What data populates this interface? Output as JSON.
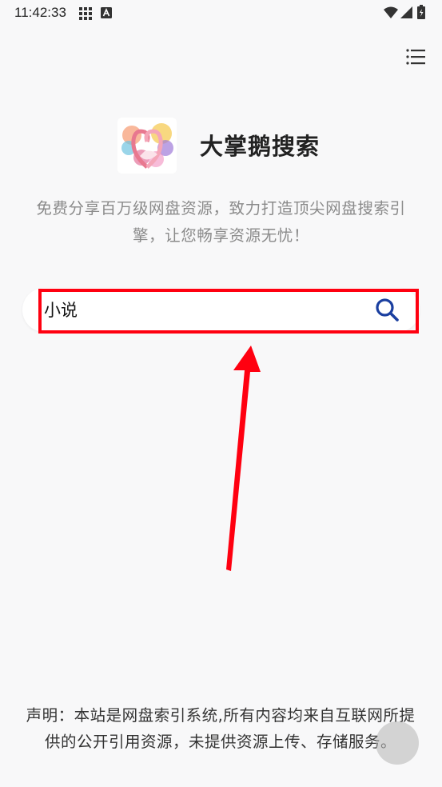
{
  "status_bar": {
    "time": "11:42:33"
  },
  "site": {
    "title": "大掌鹅搜索",
    "tagline": "免费分享百万级网盘资源，致力打造顶尖网盘搜索引擎，让您畅享资源无忧！"
  },
  "search": {
    "value": "小说"
  },
  "footer": {
    "disclaimer": "声明：本站是网盘索引系统,所有内容均来自互联网所提供的公开引用资源，未提供资源上传、存储服务。"
  },
  "icons": {
    "menu": "menu-icon",
    "search": "search-icon",
    "grid": "grid-icon",
    "keyboard": "a-icon",
    "wifi": "wifi-icon",
    "signal": "signal-icon",
    "battery": "battery-icon"
  },
  "colors": {
    "highlight": "#ff0010",
    "search_icon": "#1a3fa0",
    "background": "#f8f8f9"
  }
}
